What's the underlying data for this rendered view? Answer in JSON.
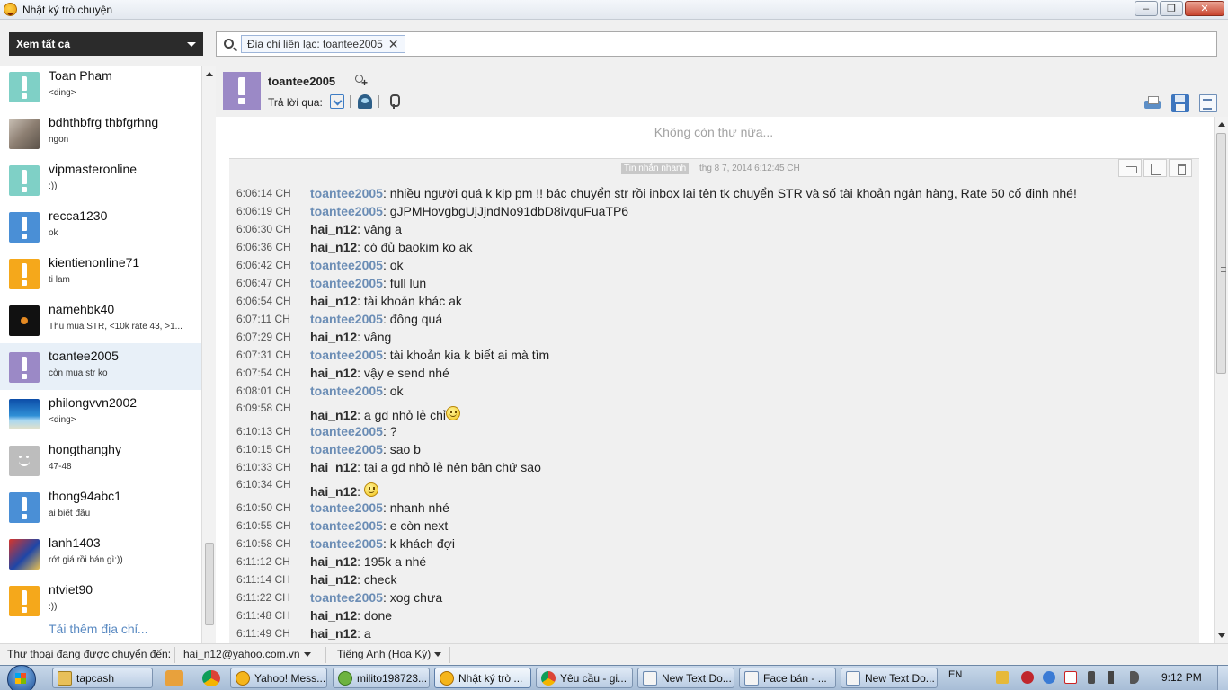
{
  "window": {
    "title": "Nhật ký trò chuyện"
  },
  "filter": {
    "view_label": "Xem tất cả",
    "token": "Địa chỉ liên lạc: toantee2005",
    "search_placeholder": ""
  },
  "contacts": [
    {
      "name": "Toan Pham",
      "status": "<ding>",
      "avatar": "teal-alert",
      "selected": false
    },
    {
      "name": "bdhthbfrg thbfgrhng",
      "status": "ngon",
      "avatar": "photo",
      "selected": false
    },
    {
      "name": "vipmasteronline",
      "status": ":))",
      "avatar": "teal-alert",
      "selected": false
    },
    {
      "name": "recca1230",
      "status": "ok",
      "avatar": "blue-alert",
      "selected": false
    },
    {
      "name": "kientienonline71",
      "status": "ti lam",
      "avatar": "orange-alert",
      "selected": false
    },
    {
      "name": "namehbk40",
      "status": "Thu mua STR, <10k rate 43, >1...",
      "avatar": "dark",
      "selected": false
    },
    {
      "name": "toantee2005",
      "status": "còn mua str ko",
      "avatar": "purple-alert",
      "selected": true
    },
    {
      "name": "philongvvn2002",
      "status": "<ding>",
      "avatar": "beach",
      "selected": false
    },
    {
      "name": "hongthanghy",
      "status": "47-48",
      "avatar": "gray-smiley",
      "selected": false
    },
    {
      "name": "thong94abc1",
      "status": "ai biết đâu",
      "avatar": "blue-alert",
      "selected": false
    },
    {
      "name": "lanh1403",
      "status": "rớt giá rồi bán gì:))",
      "avatar": "hero",
      "selected": false
    },
    {
      "name": "ntviet90",
      "status": ":))",
      "avatar": "orange-alert",
      "selected": false
    }
  ],
  "load_more": "Tải thêm địa chỉ...",
  "chat": {
    "contact_name": "toantee2005",
    "reply_label": "Trả lời qua:",
    "no_more": "Không còn thư nữa...",
    "conv_label": "Tin nhắn nhanh",
    "conv_date": "thg 8 7, 2014 6:12:45 CH",
    "messages": [
      {
        "time": "6:06:14 CH",
        "sender": "toantee2005",
        "text": ": nhiều người quá k kip pm !! bác chuyển str rồi inbox lại tên tk chuyển STR và số tài khoản ngân hàng, Rate 50 cố định nhé!",
        "emoji": false
      },
      {
        "time": "6:06:19 CH",
        "sender": "toantee2005",
        "text": ": gJPMHovgbgUjJjndNo91dbD8ivquFuaTP6",
        "emoji": false
      },
      {
        "time": "6:06:30 CH",
        "sender": "hai_n12",
        "text": ": vâng a",
        "emoji": false
      },
      {
        "time": "6:06:36 CH",
        "sender": "hai_n12",
        "text": ": có đủ baokim ko ak",
        "emoji": false
      },
      {
        "time": "6:06:42 CH",
        "sender": "toantee2005",
        "text": ": ok",
        "emoji": false
      },
      {
        "time": "6:06:47 CH",
        "sender": "toantee2005",
        "text": ": full lun",
        "emoji": false
      },
      {
        "time": "6:06:54 CH",
        "sender": "hai_n12",
        "text": ": tài khoản khác ak",
        "emoji": false
      },
      {
        "time": "6:07:11 CH",
        "sender": "toantee2005",
        "text": ": đông quá",
        "emoji": false
      },
      {
        "time": "6:07:29 CH",
        "sender": "hai_n12",
        "text": ": vâng",
        "emoji": false
      },
      {
        "time": "6:07:31 CH",
        "sender": "toantee2005",
        "text": ": tài khoản kia k biết ai mà tìm",
        "emoji": false
      },
      {
        "time": "6:07:54 CH",
        "sender": "hai_n12",
        "text": ": vậy e send nhé",
        "emoji": false
      },
      {
        "time": "6:08:01 CH",
        "sender": "toantee2005",
        "text": ": ok",
        "emoji": false
      },
      {
        "time": "6:09:58 CH",
        "sender": "hai_n12",
        "text": ": a gd nhỏ lẻ chỉ",
        "emoji": true
      },
      {
        "time": "6:10:13 CH",
        "sender": "toantee2005",
        "text": ": ?",
        "emoji": false
      },
      {
        "time": "6:10:15 CH",
        "sender": "toantee2005",
        "text": ": sao b",
        "emoji": false
      },
      {
        "time": "6:10:33 CH",
        "sender": "hai_n12",
        "text": ": tại a gd nhỏ lẻ nên bận chứ sao",
        "emoji": false
      },
      {
        "time": "6:10:34 CH",
        "sender": "hai_n12",
        "text": ": ",
        "emoji": true
      },
      {
        "time": "6:10:50 CH",
        "sender": "toantee2005",
        "text": ": nhanh nhé",
        "emoji": false
      },
      {
        "time": "6:10:55 CH",
        "sender": "toantee2005",
        "text": ": e còn next",
        "emoji": false
      },
      {
        "time": "6:10:58 CH",
        "sender": "toantee2005",
        "text": ": k khách đợi",
        "emoji": false
      },
      {
        "time": "6:11:12 CH",
        "sender": "hai_n12",
        "text": ": 195k a nhé",
        "emoji": false
      },
      {
        "time": "6:11:14 CH",
        "sender": "hai_n12",
        "text": ": check",
        "emoji": false
      },
      {
        "time": "6:11:22 CH",
        "sender": "toantee2005",
        "text": ": xog chưa",
        "emoji": false
      },
      {
        "time": "6:11:48 CH",
        "sender": "hai_n12",
        "text": ": done",
        "emoji": false
      },
      {
        "time": "6:11:49 CH",
        "sender": "hai_n12",
        "text": ": a",
        "emoji": false
      }
    ]
  },
  "status_bar": {
    "label": "Thư thoại đang được chuyển đến:",
    "account": "hai_n12@yahoo.com.vn",
    "language": "Tiếng Anh (Hoa Kỳ)"
  },
  "taskbar": {
    "apps": [
      {
        "label": "tapcash",
        "icon": "folder"
      },
      {
        "label": "Yahoo! Mess...",
        "icon": "yahoo"
      },
      {
        "label": "milito198723...",
        "icon": "msn"
      },
      {
        "label": "Nhật ký trò ...",
        "icon": "yahoo"
      },
      {
        "label": "Yêu cầu - gi...",
        "icon": "chrome"
      },
      {
        "label": "New Text Do...",
        "icon": "notepad"
      },
      {
        "label": "Face bán - ...",
        "icon": "notepad"
      },
      {
        "label": "New Text Do...",
        "icon": "notepad"
      }
    ],
    "language": "EN",
    "clock": "9:12 PM"
  },
  "colors": {
    "sender_toantee": "#6b8db5",
    "sender_hai": "#2e2e2e",
    "selected_row": "#e8f0f8"
  }
}
